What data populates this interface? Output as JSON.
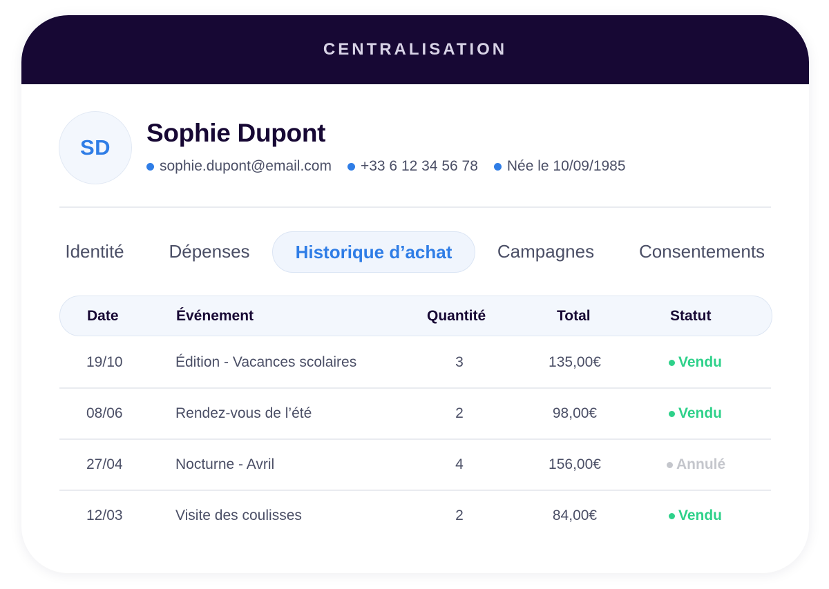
{
  "header": {
    "title": "CENTRALISATION"
  },
  "profile": {
    "initials": "SD",
    "name": "Sophie Dupont",
    "email": "sophie.dupont@email.com",
    "phone": "+33 6 12 34 56 78",
    "birth": "Née le 10/09/1985"
  },
  "tabs": [
    {
      "label": "Identité",
      "active": false
    },
    {
      "label": "Dépenses",
      "active": false
    },
    {
      "label": "Historique d’achat",
      "active": true
    },
    {
      "label": "Campagnes",
      "active": false
    },
    {
      "label": "Consentements",
      "active": false
    }
  ],
  "table": {
    "headers": {
      "date": "Date",
      "event": "Événement",
      "quantity": "Quantité",
      "total": "Total",
      "status": "Statut"
    },
    "rows": [
      {
        "date": "19/10",
        "event": "Édition - Vacances scolaires",
        "quantity": "3",
        "total": "135,00€",
        "status": "Vendu"
      },
      {
        "date": "08/06",
        "event": "Rendez-vous de l’été",
        "quantity": "2",
        "total": "98,00€",
        "status": "Vendu"
      },
      {
        "date": "27/04",
        "event": "Nocturne - Avril",
        "quantity": "4",
        "total": "156,00€",
        "status": "Annulé"
      },
      {
        "date": "12/03",
        "event": "Visite des coulisses",
        "quantity": "2",
        "total": "84,00€",
        "status": "Vendu"
      }
    ]
  },
  "colors": {
    "header_bg": "#170834",
    "accent": "#2f7de6",
    "status_sold": "#2ed18a",
    "status_cancelled": "#c4c6cc"
  }
}
